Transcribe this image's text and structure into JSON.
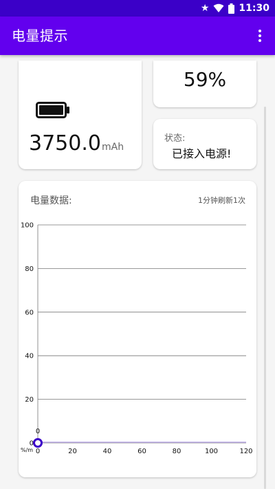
{
  "status_bar": {
    "time": "11:30"
  },
  "app_bar": {
    "title": "电量提示"
  },
  "capacity_card": {
    "value": "3750.0",
    "unit": "mAh"
  },
  "percent_card": {
    "value": "59%"
  },
  "status_card": {
    "label": "状态:",
    "value": "已接入电源!"
  },
  "chart_card": {
    "title": "电量数据:",
    "refresh_note": "1分钟刷新1次",
    "chart_data": {
      "type": "line",
      "x": [
        0
      ],
      "y": [
        0
      ],
      "point_labels": [
        "0"
      ],
      "xlim": [
        0,
        120
      ],
      "ylim": [
        0,
        100
      ],
      "xticks": [
        "0",
        "20",
        "40",
        "60",
        "80",
        "100",
        "120"
      ],
      "yticks": [
        "0",
        "20",
        "40",
        "60",
        "80",
        "100"
      ],
      "ylabel": "%/m",
      "grid": "horizontal",
      "line_color": "#3b00c8"
    }
  },
  "colors": {
    "status_bar": "#3b00c8",
    "app_bar": "#6200ee",
    "background": "#f5f5f5"
  }
}
